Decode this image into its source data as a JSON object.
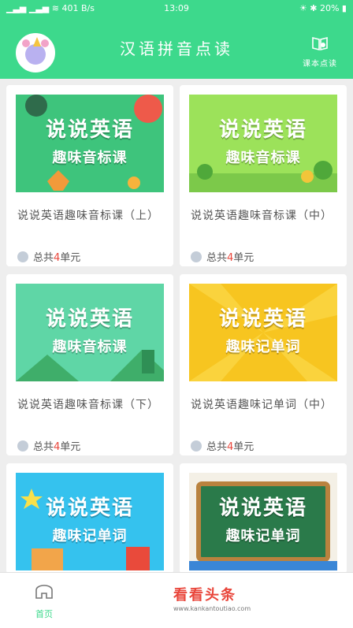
{
  "status_bar": {
    "signal": "▁▃▅ ▁▃▅ ≋",
    "speed": "401 B/s",
    "time": "13:09",
    "battery": "20%"
  },
  "header": {
    "title": "汉语拼音点读",
    "reading_label": "课本点读"
  },
  "cards": [
    {
      "banner_line1": "说说英语",
      "banner_line2": "趣味音标课",
      "name": "说说英语趣味音标课（上）",
      "units_prefix": "总共",
      "units_count": "4",
      "units_suffix": "单元",
      "bg": "#3ec47c"
    },
    {
      "banner_line1": "说说英语",
      "banner_line2": "趣味音标课",
      "name": "说说英语趣味音标课（中）",
      "units_prefix": "总共",
      "units_count": "4",
      "units_suffix": "单元",
      "bg": "#9ce25a"
    },
    {
      "banner_line1": "说说英语",
      "banner_line2": "趣味音标课",
      "name": "说说英语趣味音标课（下）",
      "units_prefix": "总共",
      "units_count": "4",
      "units_suffix": "单元",
      "bg": "#5fd6a6"
    },
    {
      "banner_line1": "说说英语",
      "banner_line2": "趣味记单词",
      "name": "说说英语趣味记单词（中）",
      "units_prefix": "总共",
      "units_count": "4",
      "units_suffix": "单元",
      "bg": "#f7c520"
    },
    {
      "banner_line1": "说说英语",
      "banner_line2": "趣味记单词",
      "name": "",
      "units_prefix": "",
      "units_count": "",
      "units_suffix": "",
      "bg": "#35c2ee"
    },
    {
      "banner_line1": "说说英语",
      "banner_line2": "趣味记单词",
      "name": "",
      "units_prefix": "",
      "units_count": "",
      "units_suffix": "",
      "bg": "#2a7a4a"
    }
  ],
  "bottom_nav": {
    "home_label": "首页"
  },
  "watermark": {
    "text": "看看头条",
    "url": "www.kankantoutiao.com"
  }
}
